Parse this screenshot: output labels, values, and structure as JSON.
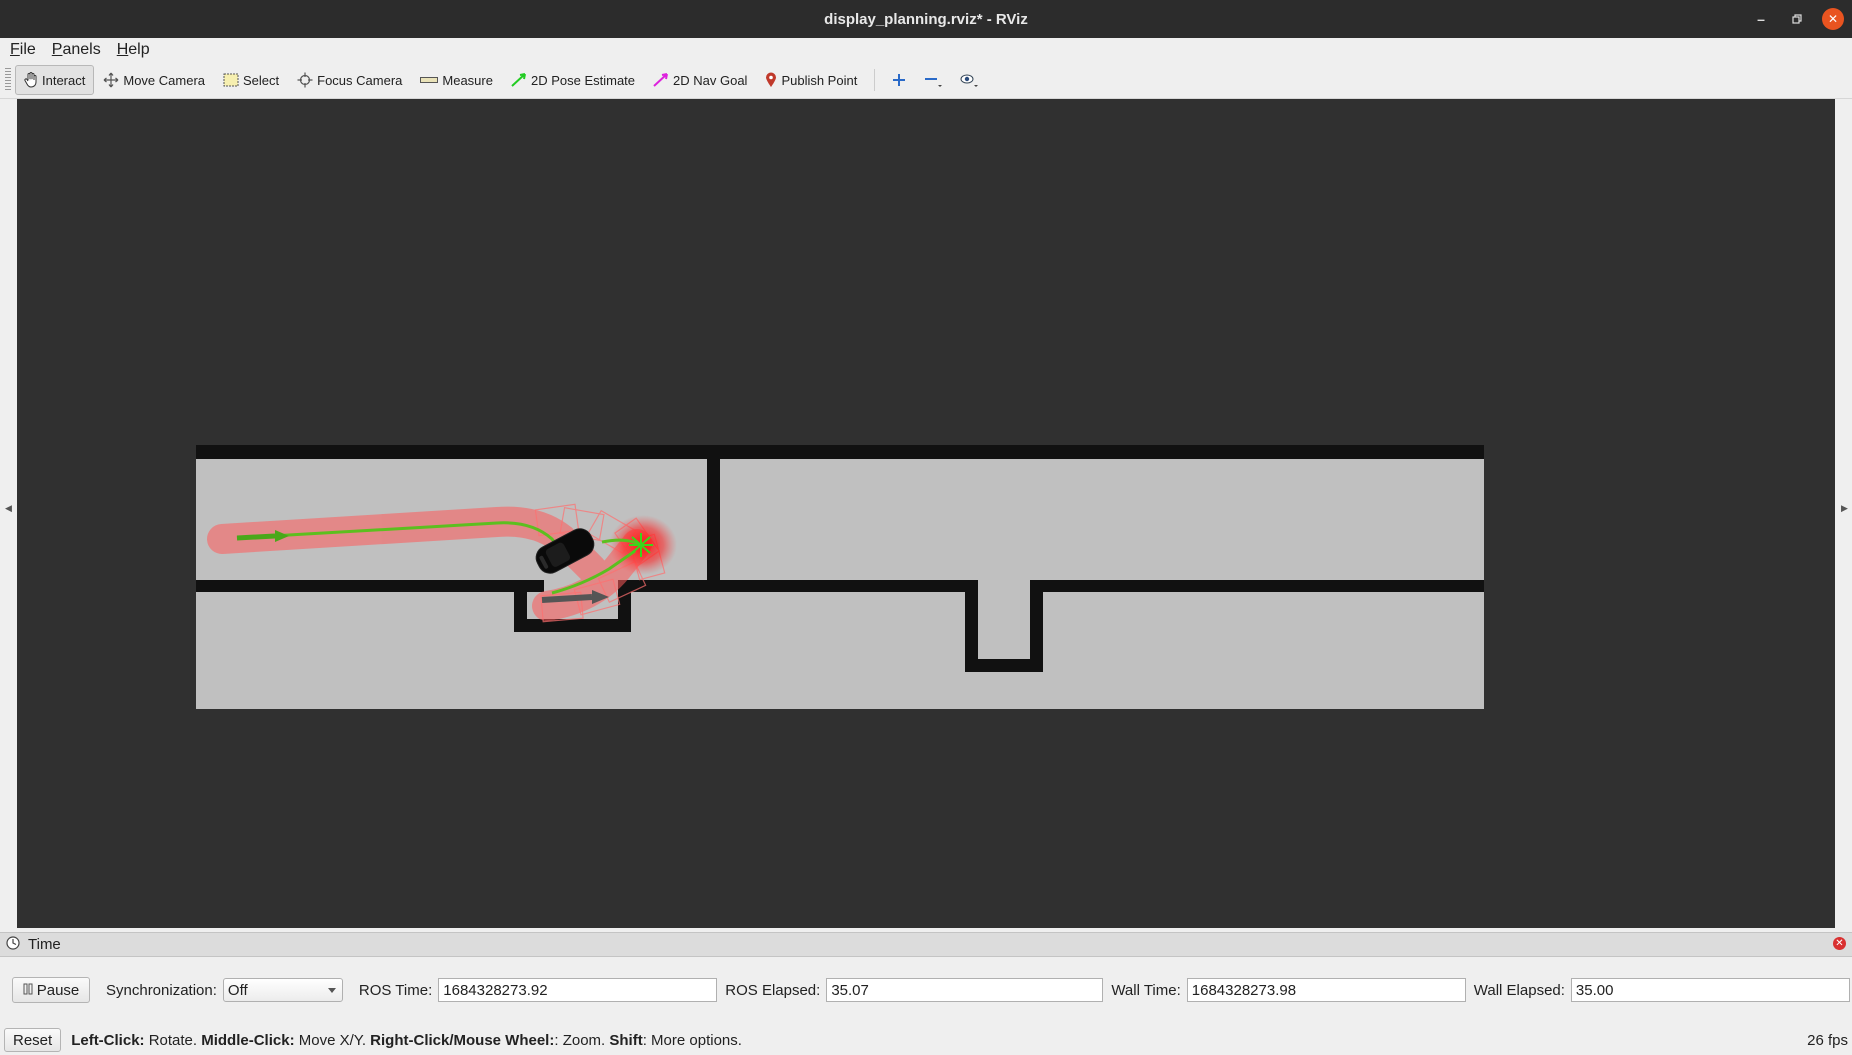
{
  "window": {
    "title": "display_planning.rviz* - RViz",
    "controls": [
      "minimize-icon",
      "restore-icon",
      "close-icon"
    ]
  },
  "menubar": {
    "items": [
      {
        "label": "File",
        "mnemonic": "F",
        "rest": "ile"
      },
      {
        "label": "Panels",
        "mnemonic": "P",
        "rest": "anels"
      },
      {
        "label": "Help",
        "mnemonic": "H",
        "rest": "elp"
      }
    ]
  },
  "toolbar": {
    "tools": [
      {
        "label": "Interact",
        "icon": "hand-icon",
        "active": true
      },
      {
        "label": "Move Camera",
        "icon": "move-icon"
      },
      {
        "label": "Select",
        "icon": "select-box-icon"
      },
      {
        "label": "Focus Camera",
        "icon": "crosshair-icon"
      },
      {
        "label": "Measure",
        "icon": "ruler-icon"
      },
      {
        "label": "2D Pose Estimate",
        "icon": "green-arrow-icon"
      },
      {
        "label": "2D Nav Goal",
        "icon": "magenta-arrow-icon"
      },
      {
        "label": "Publish Point",
        "icon": "map-pin-icon"
      }
    ],
    "extra_icons": [
      "plus-icon",
      "minus-icon",
      "eye-icon"
    ],
    "colors": {
      "pose": "#22cc22",
      "goal": "#dd22dd",
      "pin": "#c0392b"
    }
  },
  "viewport": {
    "background": "#303030",
    "map_free": "#c0c0c0",
    "walls": "#111111",
    "path_color": "#5cbf1f",
    "footprint_color": "#ff3030"
  },
  "time_panel": {
    "title": "Time",
    "pause_label": "Pause",
    "sync_label": "Synchronization:",
    "sync_value": "Off",
    "ros_time_label": "ROS Time:",
    "ros_time": "1684328273.92",
    "ros_elapsed_label": "ROS Elapsed:",
    "ros_elapsed": "35.07",
    "wall_time_label": "Wall Time:",
    "wall_time": "1684328273.98",
    "wall_elapsed_label": "Wall Elapsed:",
    "wall_elapsed": "35.00"
  },
  "statusbar": {
    "reset_label": "Reset",
    "hint_parts": [
      {
        "bold": "Left-Click:",
        "text": " Rotate. "
      },
      {
        "bold": "Middle-Click:",
        "text": " Move X/Y. "
      },
      {
        "bold": "Right-Click/Mouse Wheel:",
        "text": ": Zoom. "
      },
      {
        "bold": "Shift",
        "text": ": More options."
      }
    ],
    "fps": "26 fps"
  }
}
